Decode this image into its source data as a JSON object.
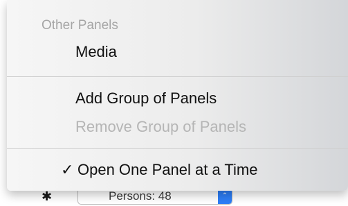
{
  "background": {
    "popup_label": "Persons: 48",
    "gear_icon": "gear-icon",
    "popup_arrow_icon": "chevron-updown-icon"
  },
  "menu": {
    "section_label": "Other Panels",
    "items": [
      {
        "label": "Media",
        "enabled": true
      },
      {
        "label": "Add Group of Panels",
        "enabled": true
      },
      {
        "label": "Remove Group of Panels",
        "enabled": false
      },
      {
        "label": "Open One Panel at a Time",
        "enabled": true,
        "checked": true,
        "check_glyph": "✓"
      }
    ]
  },
  "colors": {
    "accent": "#2d7ef7",
    "disabled_text": "#b5b5b5",
    "text": "#111111"
  }
}
